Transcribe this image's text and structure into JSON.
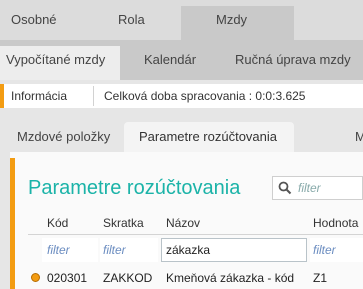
{
  "tabs_main": [
    "Osobné",
    "Rola",
    "Mzdy"
  ],
  "tabs_sub": [
    "Vypočítané mzdy",
    "Kalendár",
    "Ručná úprava mzdy"
  ],
  "info": {
    "label": "Informácia",
    "value": "Celková doba spracovania : 0:0:3.625"
  },
  "tabs_inner": [
    "Mzdové položky",
    "Parametre rozúčtovania",
    "M"
  ],
  "panel": {
    "title": "Parametre rozúčtovania",
    "search_placeholder": "filter"
  },
  "table": {
    "columns": [
      "Kód",
      "Skratka",
      "Názov",
      "Hodnota"
    ],
    "filters": [
      "filter",
      "filter",
      "zákazka",
      "filter"
    ],
    "rows": [
      {
        "kod": "020301",
        "skratka": "ZAKKOD",
        "nazov": "Kmeňová zákazka - kód",
        "hodnota": "Z1"
      }
    ]
  },
  "colors": {
    "accent": "#f39c12",
    "title": "#1bb3a8"
  }
}
